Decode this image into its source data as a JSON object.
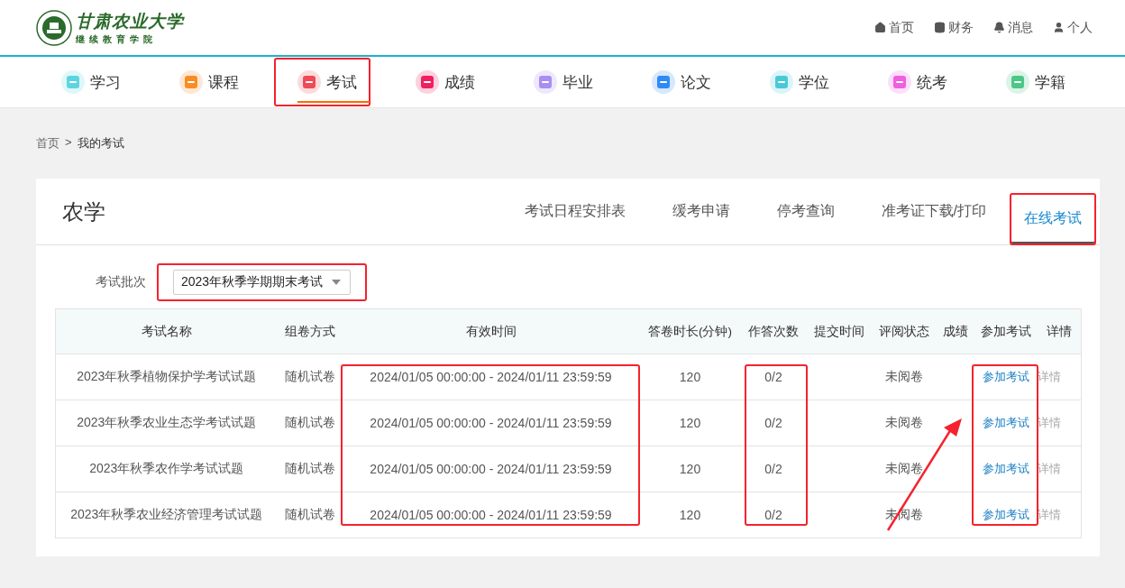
{
  "logo": {
    "title": "甘肃农业大学",
    "subtitle": "继续教育学院"
  },
  "top_links": [
    {
      "kind": "home",
      "label": "首页"
    },
    {
      "kind": "finance",
      "label": "财务"
    },
    {
      "kind": "message",
      "label": "消息"
    },
    {
      "kind": "user",
      "label": "个人"
    }
  ],
  "nav": [
    {
      "label": "学习",
      "color": "#5dd5e0",
      "selected": false,
      "highlighted": false
    },
    {
      "label": "课程",
      "color": "#fb8c23",
      "selected": false,
      "highlighted": false
    },
    {
      "label": "考试",
      "color": "#ef4b56",
      "selected": true,
      "highlighted": true
    },
    {
      "label": "成绩",
      "color": "#f0205f",
      "selected": false,
      "highlighted": false
    },
    {
      "label": "毕业",
      "color": "#a98df2",
      "selected": false,
      "highlighted": false
    },
    {
      "label": "论文",
      "color": "#2f8af5",
      "selected": false,
      "highlighted": false
    },
    {
      "label": "学位",
      "color": "#49c9d8",
      "selected": false,
      "highlighted": false
    },
    {
      "label": "统考",
      "color": "#ef5fe0",
      "selected": false,
      "highlighted": false
    },
    {
      "label": "学籍",
      "color": "#4cc787",
      "selected": false,
      "highlighted": false
    }
  ],
  "breadcrumb": [
    "首页",
    ">",
    "我的考试"
  ],
  "card": {
    "title": "农学",
    "tabs": [
      {
        "label": "考试日程安排表",
        "selected": false,
        "highlighted": false
      },
      {
        "label": "缓考申请",
        "selected": false,
        "highlighted": false
      },
      {
        "label": "停考查询",
        "selected": false,
        "highlighted": false
      },
      {
        "label": "准考证下载/打印",
        "selected": false,
        "highlighted": false
      },
      {
        "label": "在线考试",
        "selected": true,
        "highlighted": true
      }
    ],
    "batch": {
      "label": "考试批次",
      "value": "2023年秋季学期期末考试",
      "highlighted": true
    },
    "table": {
      "arrow": true,
      "columns": [
        {
          "label": "考试名称"
        },
        {
          "label": "组卷方式"
        },
        {
          "label": "有效时间",
          "highlighted": true
        },
        {
          "label": "答卷时长(分钟)"
        },
        {
          "label": "作答次数",
          "highlighted": true
        },
        {
          "label": "提交时间"
        },
        {
          "label": "评阅状态"
        },
        {
          "label": "成绩"
        },
        {
          "label": "参加考试",
          "highlighted": true
        },
        {
          "label": "详情"
        }
      ],
      "rows": [
        {
          "name": "2023年秋季植物保护学考试试题",
          "method": "随机试卷",
          "time": "2024/01/05 00:00:00 - 2024/01/11 23:59:59",
          "duration": "120",
          "attempts": "0/2",
          "status": "未阅卷",
          "join": "参加考试",
          "details": "详情"
        },
        {
          "name": "2023年秋季农业生态学考试试题",
          "method": "随机试卷",
          "time": "2024/01/05 00:00:00 - 2024/01/11 23:59:59",
          "duration": "120",
          "attempts": "0/2",
          "status": "未阅卷",
          "join": "参加考试",
          "details": "详情"
        },
        {
          "name": "2023年秋季农作学考试试题",
          "method": "随机试卷",
          "time": "2024/01/05 00:00:00 - 2024/01/11 23:59:59",
          "duration": "120",
          "attempts": "0/2",
          "status": "未阅卷",
          "join": "参加考试",
          "details": "详情"
        },
        {
          "name": "2023年秋季农业经济管理考试试题",
          "method": "随机试卷",
          "time": "2024/01/05 00:00:00 - 2024/01/11 23:59:59",
          "duration": "120",
          "attempts": "0/2",
          "status": "未阅卷",
          "join": "参加考试",
          "details": "详情"
        }
      ]
    }
  }
}
